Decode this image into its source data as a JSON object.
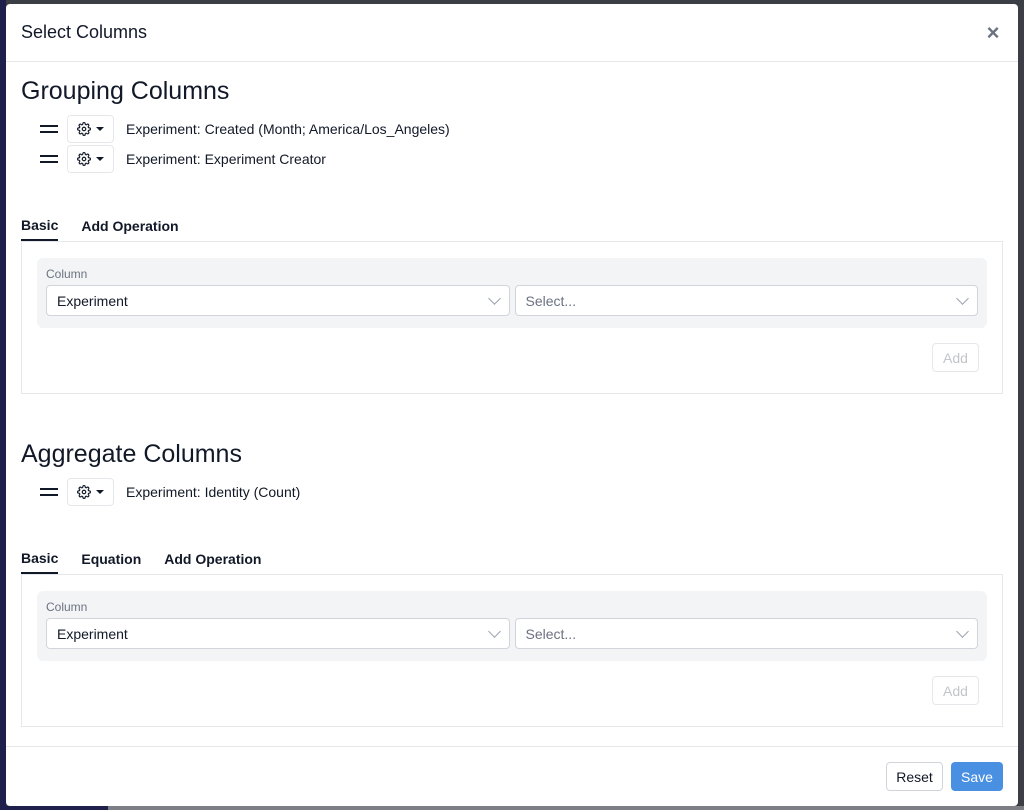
{
  "modal": {
    "title": "Select Columns",
    "close_label": "×"
  },
  "grouping": {
    "title": "Grouping Columns",
    "columns": [
      {
        "label": "Experiment: Created (Month; America/Los_Angeles)"
      },
      {
        "label": "Experiment: Experiment Creator"
      }
    ],
    "tabs": [
      {
        "label": "Basic",
        "active": true
      },
      {
        "label": "Add Operation",
        "active": false
      }
    ],
    "column_field_label": "Column",
    "column_select_value": "Experiment",
    "second_select_placeholder": "Select...",
    "add_label": "Add"
  },
  "aggregate": {
    "title": "Aggregate Columns",
    "columns": [
      {
        "label": "Experiment: Identity (Count)"
      }
    ],
    "tabs": [
      {
        "label": "Basic",
        "active": true
      },
      {
        "label": "Equation",
        "active": false
      },
      {
        "label": "Add Operation",
        "active": false
      }
    ],
    "column_field_label": "Column",
    "column_select_value": "Experiment",
    "second_select_placeholder": "Select...",
    "add_label": "Add"
  },
  "footer": {
    "reset_label": "Reset",
    "save_label": "Save"
  },
  "colors": {
    "primary": "#4a90e2",
    "text": "#111827",
    "muted": "#6b7280",
    "border": "#e5e7eb",
    "card_bg": "#f3f4f6"
  },
  "icons": {
    "drag": "drag-handle-icon",
    "gear": "gear-icon",
    "caret": "caret-down-icon",
    "chevron": "chevron-down-icon",
    "close": "close-icon"
  }
}
